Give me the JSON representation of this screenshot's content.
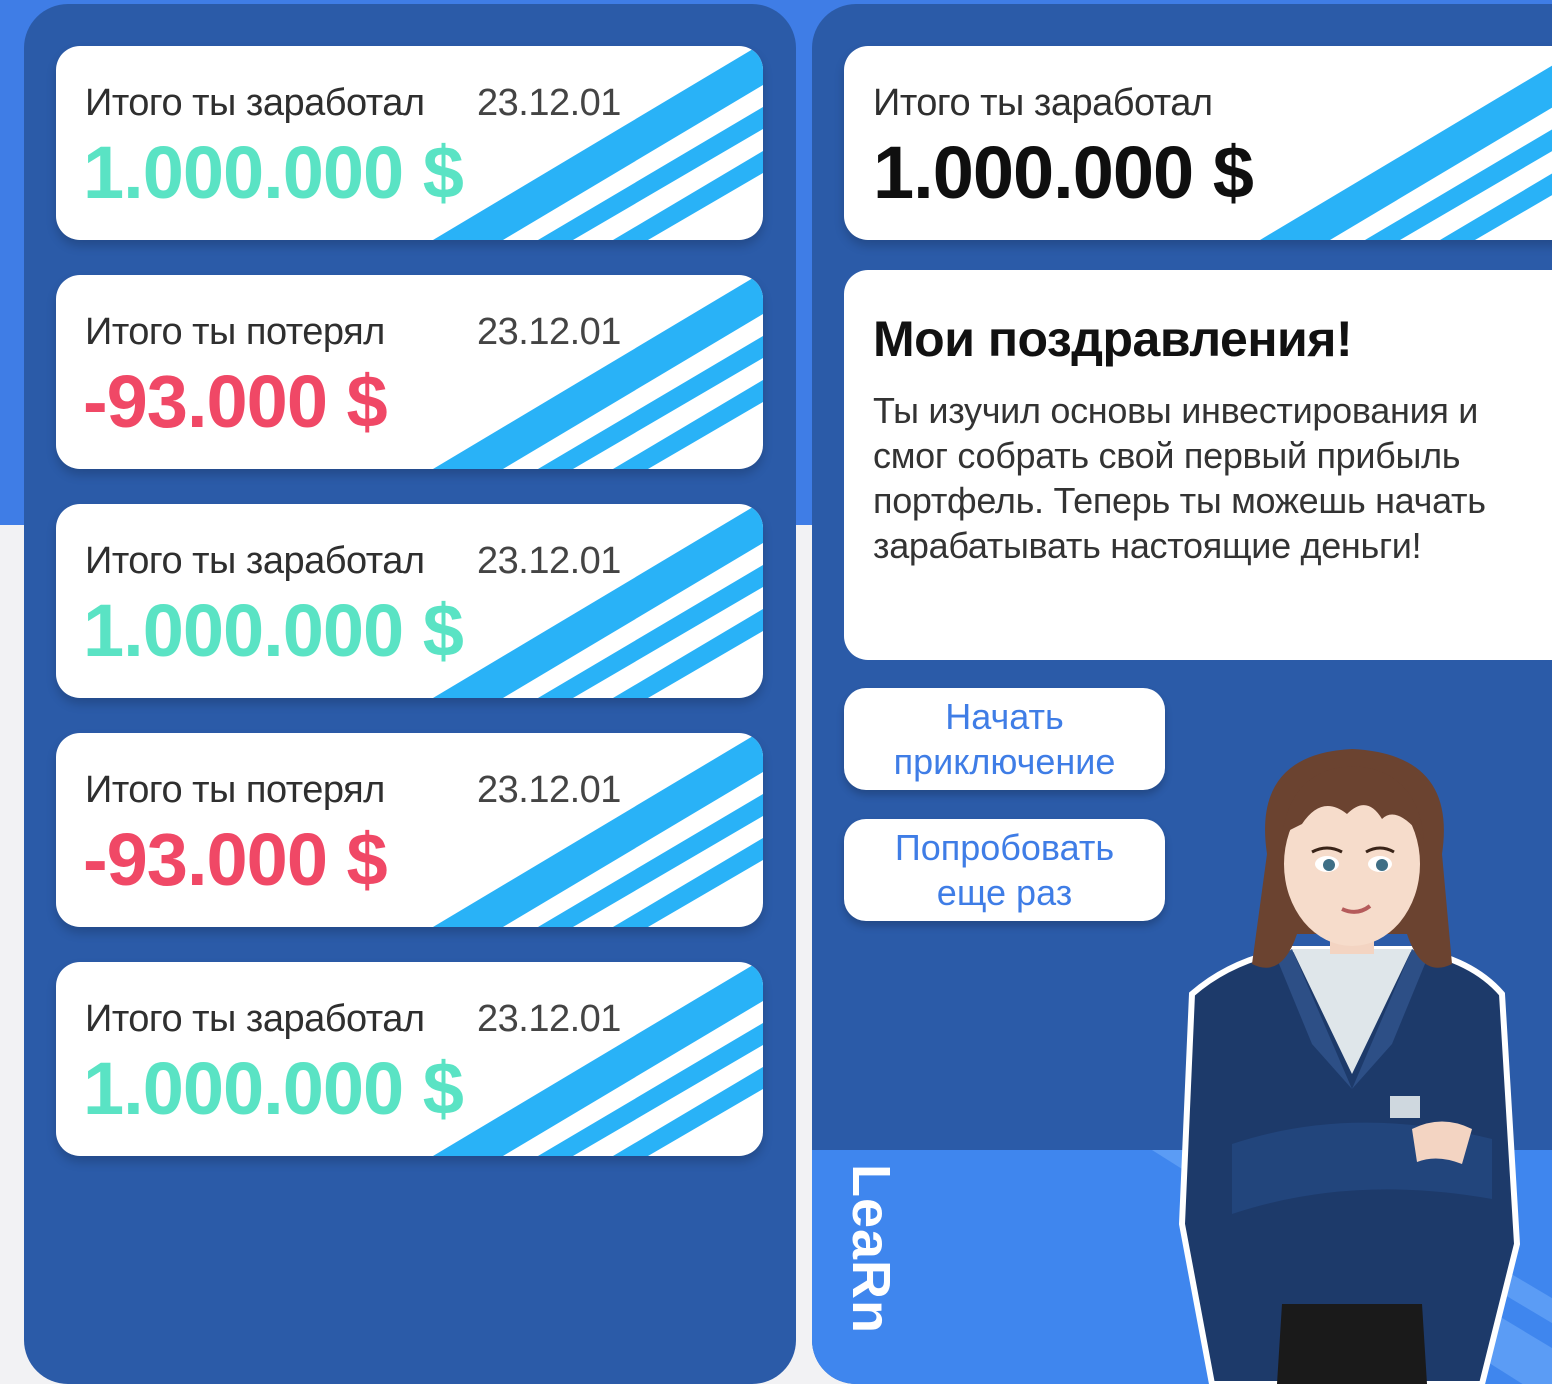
{
  "colors": {
    "page_blue": "#3f7de6",
    "panel_blue": "#2b5ba8",
    "stripe_blue": "#29b2f7",
    "profit_green": "#5ae3c4",
    "loss_red": "#f04866",
    "link_blue": "#3f7de6"
  },
  "history": [
    {
      "label": "Итого ты заработал",
      "date": "23.12.01",
      "amount": "1.000.000 $",
      "kind": "profit"
    },
    {
      "label": "Итого ты потерял",
      "date": "23.12.01",
      "amount": "-93.000 $",
      "kind": "loss"
    },
    {
      "label": "Итого ты заработал",
      "date": "23.12.01",
      "amount": "1.000.000 $",
      "kind": "profit"
    },
    {
      "label": "Итого ты потерял",
      "date": "23.12.01",
      "amount": "-93.000 $",
      "kind": "loss"
    },
    {
      "label": "Итого ты заработал",
      "date": "23.12.01",
      "amount": "1.000.000 $",
      "kind": "profit"
    }
  ],
  "summary": {
    "label": "Итого ты заработал",
    "amount": "1.000.000 $"
  },
  "congrats": {
    "title": "Мои поздравления!",
    "text": "Ты изучил основы инвестирования и смог собрать свой первый прибыль портфель. Теперь ты можешь начать зарабатывать настоящие деньги!"
  },
  "buttons": {
    "adventure": "Начать приключение",
    "retry": "Попробовать еще раз"
  },
  "brand": {
    "logo_text": "LeaRn"
  },
  "icons": {
    "card_decoration": "diagonal-stripes-icon",
    "mascot": "mascot-character"
  }
}
